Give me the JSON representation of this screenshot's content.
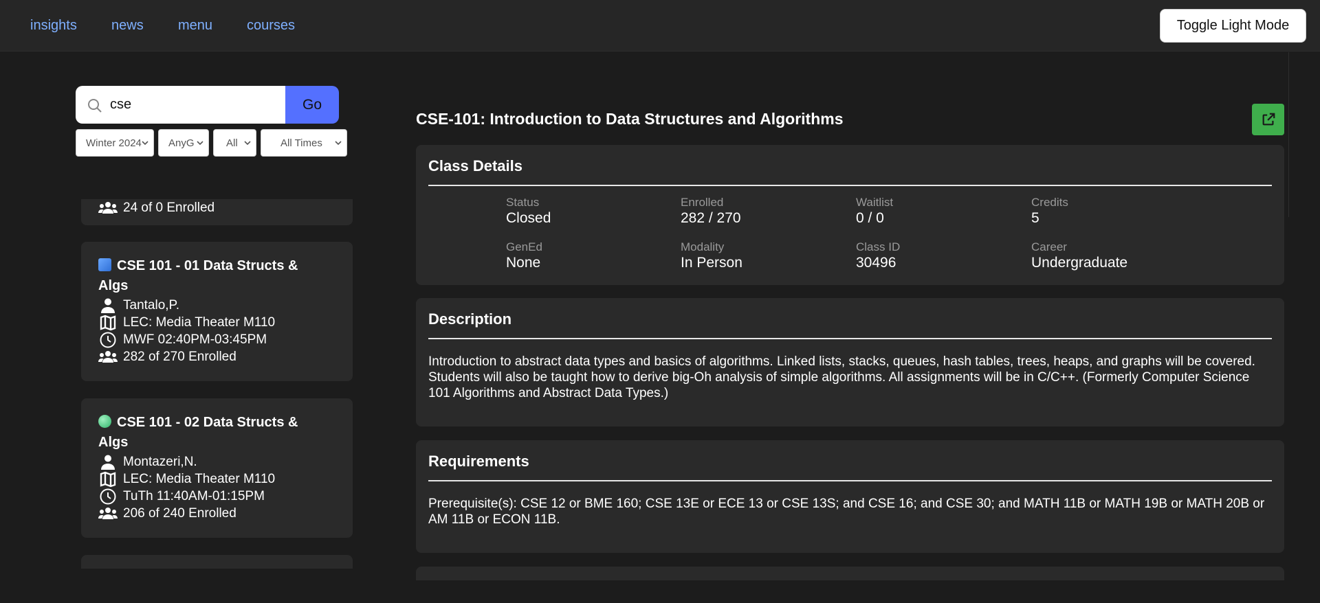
{
  "nav": {
    "links": [
      "insights",
      "news",
      "menu",
      "courses"
    ],
    "toggle_label": "Toggle Light Mode"
  },
  "search": {
    "value": "cse",
    "go_label": "Go",
    "filters": [
      "Winter 2024",
      "AnyGE",
      "All",
      "All Times"
    ]
  },
  "list": {
    "partial_card_enrolled": "24 of 0 Enrolled",
    "cards": [
      {
        "status_icon": "blue-square",
        "title": "CSE 101 - 01 Data Structs & Algs",
        "instructor": "Tantalo,P.",
        "location": "LEC: Media Theater M110",
        "time": "MWF 02:40PM-03:45PM",
        "enrolled": "282 of 270 Enrolled"
      },
      {
        "status_icon": "green-circle",
        "title": "CSE 101 - 02 Data Structs & Algs",
        "instructor": "Montazeri,N.",
        "location": "LEC: Media Theater M110",
        "time": "TuTh 11:40AM-01:15PM",
        "enrolled": "206 of 240 Enrolled"
      }
    ]
  },
  "detail": {
    "title": "CSE-101: Introduction to Data Structures and Algorithms",
    "class_details": {
      "heading": "Class Details",
      "stats": [
        {
          "label": "Status",
          "value": "Closed"
        },
        {
          "label": "Enrolled",
          "value": "282 / 270"
        },
        {
          "label": "Waitlist",
          "value": "0 / 0"
        },
        {
          "label": "Credits",
          "value": "5"
        },
        {
          "label": "GenEd",
          "value": "None"
        },
        {
          "label": "Modality",
          "value": "In Person"
        },
        {
          "label": "Class ID",
          "value": "30496"
        },
        {
          "label": "Career",
          "value": "Undergraduate"
        }
      ]
    },
    "description": {
      "heading": "Description",
      "text": "Introduction to abstract data types and basics of algorithms. Linked lists, stacks, queues, hash tables, trees, heaps, and graphs will be covered. Students will also be taught how to derive big-Oh analysis of simple algorithms. All assignments will be in C/C++. (Formerly Computer Science 101 Algorithms and Abstract Data Types.)"
    },
    "requirements": {
      "heading": "Requirements",
      "text": "Prerequisite(s): CSE 12 or BME 160; CSE 13E or ECE 13 or CSE 13S; and CSE 16; and CSE 30; and MATH 11B or MATH 19B or MATH 20B or AM 11B or ECON 11B."
    }
  },
  "colors": {
    "background": "#1c1c1c",
    "nav_bg": "#262626",
    "panel_bg": "#2a2a2a",
    "link": "#7fb0ff",
    "go_button": "#5470ff",
    "external_button": "#3fae4c",
    "muted_label": "#9a9a9a"
  },
  "icons": [
    "search-icon",
    "chevron-down-icon",
    "person-icon",
    "map-icon",
    "clock-icon",
    "users-icon",
    "external-link-icon"
  ]
}
